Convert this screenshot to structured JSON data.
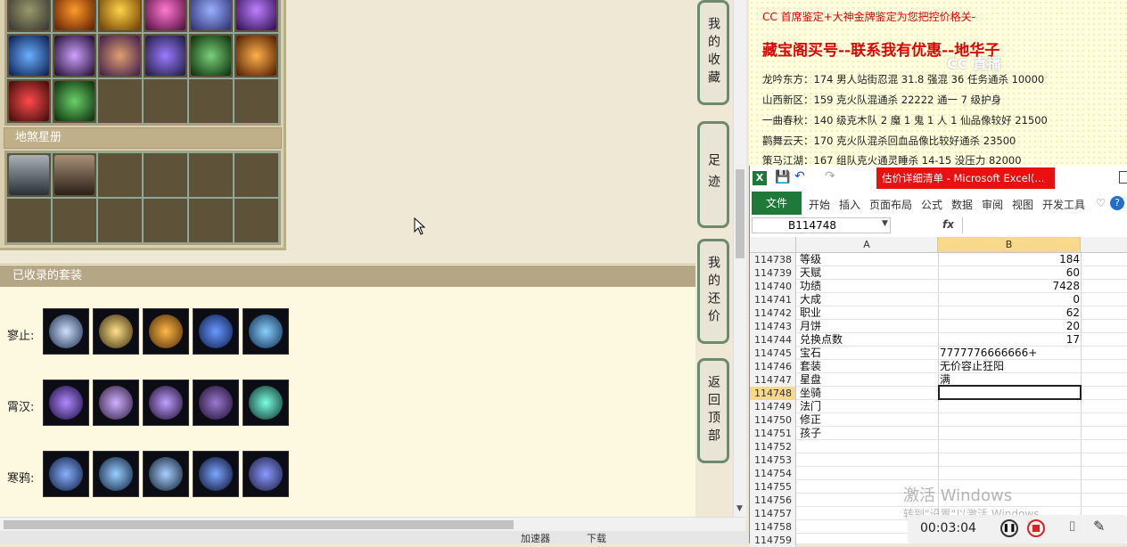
{
  "game": {
    "star_section_title": "地煞星册",
    "suit_section_title": "已收录的套装",
    "suits": [
      {
        "label": "寥止:"
      },
      {
        "label": "霄汉:"
      },
      {
        "label": "寒鸦:"
      }
    ],
    "nav": [
      {
        "label": "我的收藏"
      },
      {
        "label": "足迹"
      },
      {
        "label": "我的还价"
      },
      {
        "label": "返回顶部"
      }
    ],
    "status_items": [
      "加速器",
      "下载"
    ]
  },
  "document": {
    "line_top": "CC 首席鉴定+大神金牌鉴定为您把控价格关-",
    "headline": "藏宝阁买号--联系我有优惠--地华子",
    "watermark": "CC 直播",
    "lines": [
      "龙吟东方：174 男人站街忍混 31.8 强混 36 任务通杀 10000",
      "山西新区：159 克火队混通杀 22222 通一 7 级护身",
      "一曲春秋：140 级克木队 2 魔 1 鬼 1 人 1 仙品像较好 21500",
      "鹳舞云天：170 克火队混杀回血品像比较好通杀 23500",
      "策马江湖：167 组队克火通灵睡杀 14-15 没压力 82000"
    ]
  },
  "excel": {
    "title": "估价详细清单 - Microsoft Excel(...",
    "file_tab": "文件",
    "ribbon_tabs": [
      "开始",
      "插入",
      "页面布局",
      "公式",
      "数据",
      "审阅",
      "视图",
      "开发工具"
    ],
    "name_box": "B114748",
    "fx": "fx",
    "col_a": "A",
    "col_b": "B",
    "rows": [
      {
        "n": "114738",
        "a": "等级",
        "b": "184"
      },
      {
        "n": "114739",
        "a": "天赋",
        "b": "60"
      },
      {
        "n": "114740",
        "a": "功绩",
        "b": "7428"
      },
      {
        "n": "114741",
        "a": "大成",
        "b": "0"
      },
      {
        "n": "114742",
        "a": "职业",
        "b": "62"
      },
      {
        "n": "114743",
        "a": "月饼",
        "b": "20"
      },
      {
        "n": "114744",
        "a": "兑换点数",
        "b": "17"
      },
      {
        "n": "114745",
        "a": "宝石",
        "b": "7777776666666+"
      },
      {
        "n": "114746",
        "a": "套装",
        "b": "无价容止狂阳"
      },
      {
        "n": "114747",
        "a": "星盘",
        "b": "满"
      },
      {
        "n": "114748",
        "a": "坐骑",
        "b": ""
      },
      {
        "n": "114749",
        "a": "法门",
        "b": ""
      },
      {
        "n": "114750",
        "a": "修正",
        "b": ""
      },
      {
        "n": "114751",
        "a": "孩子",
        "b": ""
      },
      {
        "n": "114752",
        "a": "",
        "b": ""
      },
      {
        "n": "114753",
        "a": "",
        "b": ""
      },
      {
        "n": "114754",
        "a": "",
        "b": ""
      },
      {
        "n": "114755",
        "a": "",
        "b": ""
      },
      {
        "n": "114756",
        "a": "",
        "b": ""
      },
      {
        "n": "114757",
        "a": "",
        "b": ""
      },
      {
        "n": "114758",
        "a": "",
        "b": ""
      },
      {
        "n": "114759",
        "a": "",
        "b": ""
      }
    ],
    "activation_title": "激活 Windows",
    "activation_sub": "转到\"设置\"以激活 Windows。"
  },
  "recorder": {
    "time": "00:03:04"
  }
}
